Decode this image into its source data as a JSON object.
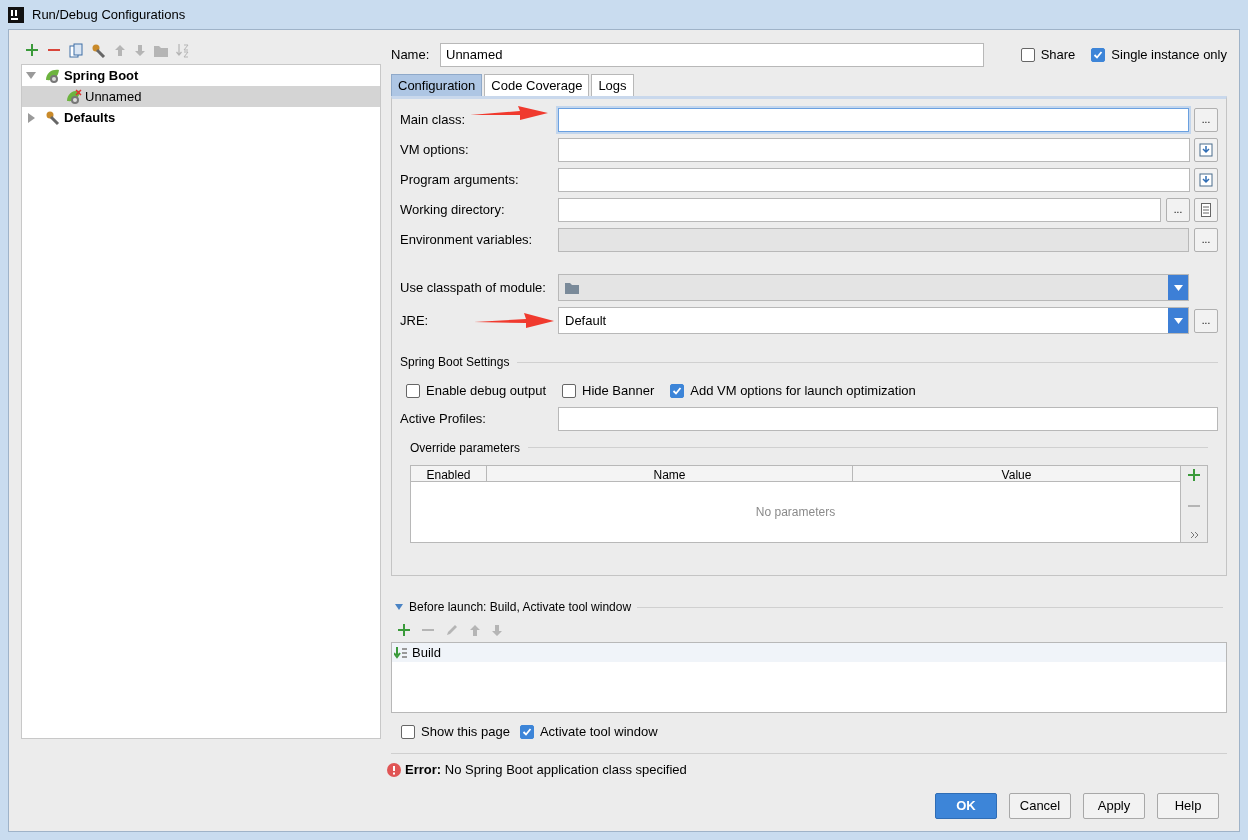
{
  "window": {
    "title": "Run/Debug Configurations"
  },
  "toolbar": [
    {
      "kind": "add",
      "disabled": false
    },
    {
      "kind": "remove",
      "disabled": false
    },
    {
      "kind": "copy",
      "disabled": false
    },
    {
      "kind": "wrench",
      "disabled": false
    },
    {
      "kind": "up",
      "disabled": true
    },
    {
      "kind": "down",
      "disabled": true
    },
    {
      "kind": "folder",
      "disabled": true
    },
    {
      "kind": "sort",
      "disabled": true
    }
  ],
  "tree": [
    {
      "label": "Spring Boot",
      "kind": "spring",
      "expanded": true,
      "selected": false,
      "children": [
        {
          "label": "Unnamed",
          "kind": "spring-error",
          "selected": true
        }
      ]
    },
    {
      "label": "Defaults",
      "kind": "defaults",
      "expanded": false,
      "selected": false
    }
  ],
  "name_field": {
    "label": "Name:",
    "value": "Unnamed"
  },
  "header_checkboxes": [
    {
      "label": "Share",
      "checked": false
    },
    {
      "label": "Single instance only",
      "checked": true
    }
  ],
  "tabs": [
    {
      "label": "Configuration",
      "selected": true
    },
    {
      "label": "Code Coverage",
      "selected": false
    },
    {
      "label": "Logs",
      "selected": false
    }
  ],
  "fields": [
    {
      "label": "Main class:",
      "kind": "text",
      "focused": true,
      "disabled": false,
      "buttons": [
        {
          "kind": "browse",
          "text": "..."
        }
      ]
    },
    {
      "label": "VM options:",
      "kind": "text",
      "focused": false,
      "disabled": false,
      "buttons": [
        {
          "kind": "expand"
        }
      ]
    },
    {
      "label": "Program arguments:",
      "kind": "text",
      "focused": false,
      "disabled": false,
      "buttons": [
        {
          "kind": "expand"
        }
      ]
    },
    {
      "label": "Working directory:",
      "kind": "text",
      "focused": false,
      "disabled": false,
      "buttons": [
        {
          "kind": "browse",
          "text": "..."
        },
        {
          "kind": "macro"
        }
      ]
    },
    {
      "label": "Environment variables:",
      "kind": "text",
      "focused": false,
      "disabled": true,
      "buttons": [
        {
          "kind": "browse",
          "text": "..."
        }
      ]
    },
    {
      "label": "Use classpath of module:",
      "kind": "select"
    },
    {
      "label": "JRE:",
      "kind": "select",
      "value": "Default",
      "buttons": [
        {
          "kind": "browse",
          "text": "..."
        }
      ]
    }
  ],
  "spring_boot_settings": {
    "title": "Spring Boot Settings",
    "checkboxes": [
      {
        "label": "Enable debug output",
        "checked": false
      },
      {
        "label": "Hide Banner",
        "checked": false
      },
      {
        "label": "Add VM options for launch optimization",
        "checked": true
      }
    ],
    "active_profiles": {
      "label": "Active Profiles:"
    }
  },
  "override_parameters": {
    "title": "Override parameters",
    "columns": [
      "Enabled",
      "Name",
      "Value"
    ],
    "empty_text": "No parameters",
    "side_buttons": [
      {
        "kind": "add",
        "disabled": false
      },
      {
        "kind": "remove",
        "disabled": true
      },
      {
        "kind": "more",
        "disabled": false
      }
    ]
  },
  "before_launch": {
    "title": "Before launch: Build, Activate tool window",
    "expanded": true,
    "toolbar": [
      {
        "kind": "add",
        "disabled": false
      },
      {
        "kind": "remove",
        "disabled": true
      },
      {
        "kind": "edit",
        "disabled": true
      },
      {
        "kind": "up",
        "disabled": true
      },
      {
        "kind": "down",
        "disabled": true
      }
    ],
    "items": [
      {
        "label": "Build",
        "selected": false
      }
    ],
    "checkboxes": [
      {
        "label": "Show this page",
        "checked": false
      },
      {
        "label": "Activate tool window",
        "checked": true
      }
    ]
  },
  "error": "**Error:** No Spring Boot application class specified",
  "buttons": [
    {
      "label": "OK",
      "default": true
    },
    {
      "label": "Cancel",
      "default": false
    },
    {
      "label": "Apply",
      "default": false
    },
    {
      "label": "Help",
      "default": false
    }
  ]
}
